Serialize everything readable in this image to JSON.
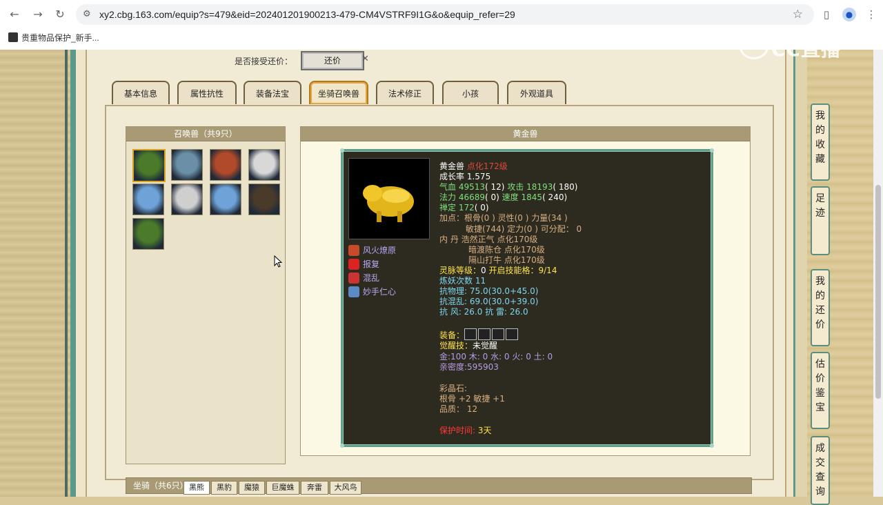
{
  "browser": {
    "url": "xy2.cbg.163.com/equip?s=479&eid=202401201900213-479-CM4VSTRF9I1G&o&equip_refer=29",
    "bookmark": "贵重物品保护_新手..."
  },
  "watermark": "CC直播",
  "counter_offer": {
    "label": "是否接受还价：",
    "button": "还价"
  },
  "tabs": [
    "基本信息",
    "属性抗性",
    "装备法宝",
    "坐骑召唤兽",
    "法术修正",
    "小孩",
    "外观道具"
  ],
  "active_tab": "坐骑召唤兽",
  "pet_list": {
    "title": "召唤兽（共9只）",
    "icons": [
      {
        "name": "green-goblin",
        "color": "#4a7a2a"
      },
      {
        "name": "armored-beast",
        "color": "#6b8fa6"
      },
      {
        "name": "monkey-king",
        "color": "#b04a2a"
      },
      {
        "name": "white-bear",
        "color": "#d8d8d8"
      },
      {
        "name": "ice-spirit",
        "color": "#6fa3d8"
      },
      {
        "name": "white-goat",
        "color": "#cfcfcf"
      },
      {
        "name": "ice-spirit",
        "color": "#6fa3d8"
      },
      {
        "name": "black-yak",
        "color": "#4a3a2a"
      },
      {
        "name": "green-goblin",
        "color": "#4a7a2a"
      }
    ]
  },
  "detail": {
    "title": "黄金兽",
    "skills": [
      {
        "label": "风火燎原",
        "color": "#c84a2a"
      },
      {
        "label": "报复",
        "color": "#d22"
      },
      {
        "label": "混乱",
        "color": "#c33"
      },
      {
        "label": "妙手仁心",
        "color": "#5a8ac8"
      }
    ],
    "name": "黄金兽",
    "level": "点化172级",
    "growth_label": "成长率",
    "growth": "1.575",
    "hp_label": "气血",
    "hp": "49513",
    "hp_extra": "( 12)",
    "atk_label": "攻击",
    "atk": "18193",
    "atk_extra": "( 180)",
    "mp_label": "法力",
    "mp": "46689",
    "mp_extra": "( 0)",
    "spd_label": "速度",
    "spd": "1845",
    "spd_extra": "( 240)",
    "zen_label": "禅定",
    "zen": "172",
    "zen_extra": "( 0)",
    "points_line1": "加点：根骨(0 ) 灵性(0 ) 力量(34 )",
    "points_line2": "敏捷(744) 定力(0 ) 可分配： 0",
    "neidan_label": "内  丹",
    "neidan": [
      "浩然正气 点化170级",
      "暗渡陈仓 点化170级",
      "隔山打牛 点化170级"
    ],
    "spirit_label": "灵脉等级：",
    "spirit_value": "0",
    "skill_slots_label": "开启技能格：",
    "skill_slots_value": "9/14",
    "refine_label": "炼妖次数",
    "refine_value": "11",
    "resist_phys": "抗物理: 75.0(30.0+45.0)",
    "resist_chaos": "抗混乱: 69.0(30.0+39.0)",
    "resist_wind": "抗  风: 26.0 抗  雷: 26.0",
    "equip_label": "装备：",
    "awaken_label": "觉醒技：",
    "awaken_value": "未觉醒",
    "elements": "金:100 木: 0 水: 0 火: 0 土: 0",
    "intimacy": "亲密度:595903",
    "gem_label": "彩晶石:",
    "gem_value": "根骨 +2 敏捷 +1",
    "quality": "品质： 12",
    "protect_label": "保护时间:",
    "protect_value": "3天"
  },
  "mounts": {
    "title": "坐骑（共6只）",
    "tabs": [
      "黑熊",
      "黑豹",
      "魔猿",
      "巨魔蛛",
      "奔雷",
      "大风鸟"
    ]
  },
  "side_buttons": [
    {
      "label": "我的收藏",
      "chars": [
        "我",
        "的",
        "收",
        "藏"
      ]
    },
    {
      "label": "足迹",
      "chars": [
        "足",
        "迹"
      ]
    },
    {
      "label": "我的还价",
      "chars": [
        "我",
        "的",
        "还",
        "价"
      ]
    },
    {
      "label": "估价鉴宝",
      "chars": [
        "估",
        "价",
        "鉴",
        "宝"
      ]
    },
    {
      "label": "成交查询",
      "chars": [
        "成",
        "交",
        "查",
        "询"
      ]
    }
  ]
}
